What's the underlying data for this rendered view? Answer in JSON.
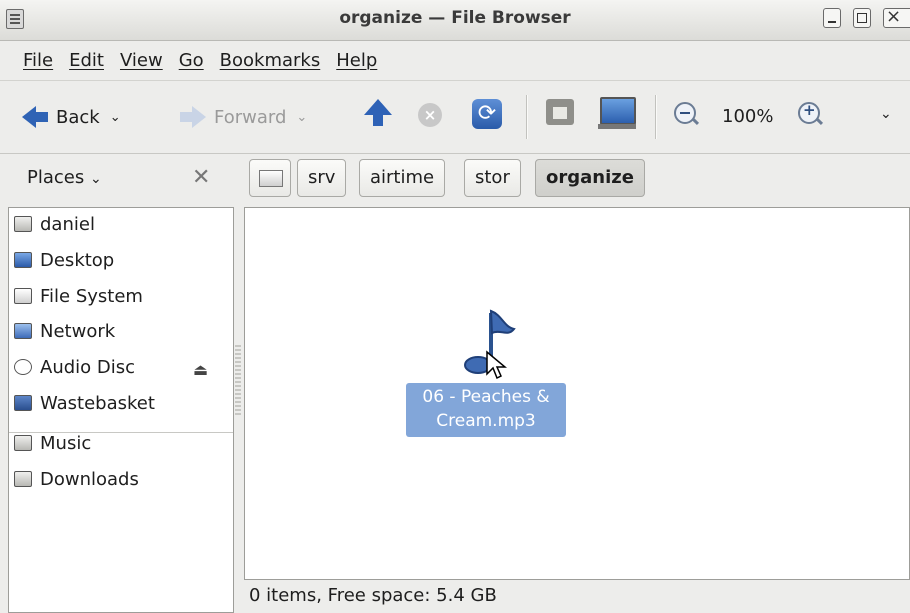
{
  "window": {
    "title": "organize — File Browser"
  },
  "menubar": [
    "File",
    "Edit",
    "View",
    "Go",
    "Bookmarks",
    "Help"
  ],
  "toolbar": {
    "back_label": "Back",
    "forward_label": "Forward",
    "zoom_level": "100%"
  },
  "places": {
    "label": "Places",
    "chevron": "⌄",
    "close_glyph": "✕",
    "items": [
      {
        "label": "daniel",
        "icon": "home-folder-icon"
      },
      {
        "label": "Desktop",
        "icon": "desktop-icon"
      },
      {
        "label": "File System",
        "icon": "filesystem-icon"
      },
      {
        "label": "Network",
        "icon": "network-icon"
      },
      {
        "label": "Audio Disc",
        "icon": "disc-icon"
      },
      {
        "label": "Wastebasket",
        "icon": "trash-icon"
      },
      {
        "label": "Music",
        "icon": "folder-icon"
      },
      {
        "label": "Downloads",
        "icon": "folder-icon"
      }
    ]
  },
  "pathbar": [
    "srv",
    "airtime",
    "stor",
    "organize"
  ],
  "file": {
    "name_line1": "06 - Peaches &",
    "name_line2": "Cream.mp3"
  },
  "status": "0 items, Free space: 5.4 GB",
  "colors": {
    "accent": "#2f63b5",
    "selection": "#82a6d9"
  }
}
